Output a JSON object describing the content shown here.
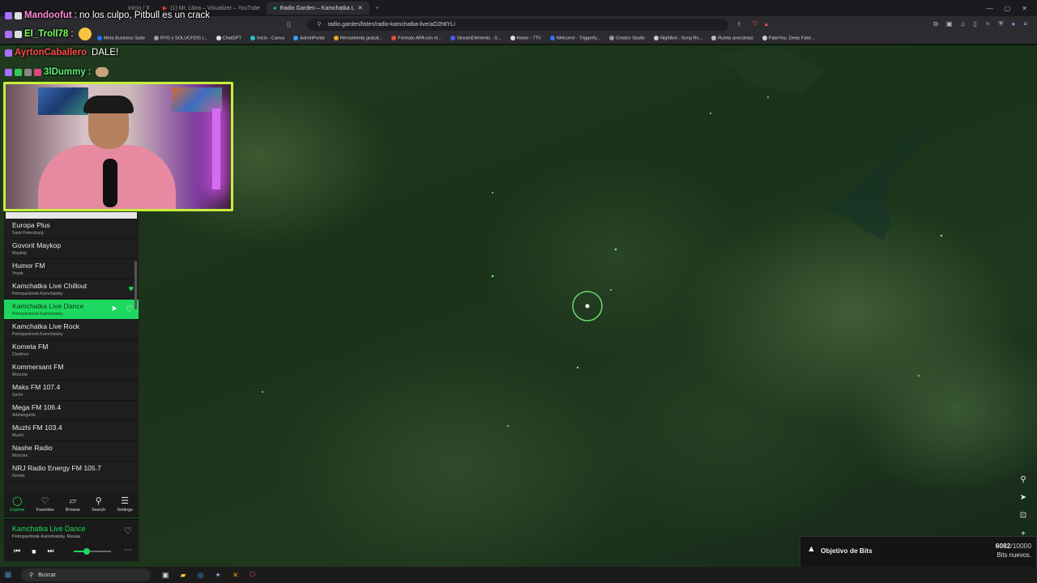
{
  "browser": {
    "tabs": [
      {
        "label": "Inicio / X",
        "active": false
      },
      {
        "label": "(1) Mr. Libra – Visualizer – YouTube",
        "active": false
      },
      {
        "label": "Radio Garden – Kamchatka L",
        "active": true
      }
    ],
    "url": "radio.garden/listen/radio-kamchatka-live/aO2h8YLi",
    "bookmarks": [
      {
        "label": "Meta Business Suite",
        "color": "#1877f2"
      },
      {
        "label": "RYG y SOLUCFDIS |...",
        "color": "#999999"
      },
      {
        "label": "ChatGPT",
        "color": "#dddddd"
      },
      {
        "label": "Inicio - Canva",
        "color": "#20c4cb"
      },
      {
        "label": "AdminPortal",
        "color": "#3aa0ff"
      },
      {
        "label": "Herramienta gratuit...",
        "color": "#f5a623"
      },
      {
        "label": "Formato APA con el...",
        "color": "#e74c3c"
      },
      {
        "label": "StreamElements - S...",
        "color": "#4a5bff"
      },
      {
        "label": "Home - 7TV",
        "color": "#dddddd"
      },
      {
        "label": "Welcome - Triggerfy...",
        "color": "#3a6dff"
      },
      {
        "label": "Creator Studio",
        "color": "#999999"
      },
      {
        "label": "Nightbot - Song Re...",
        "color": "#cccccc"
      },
      {
        "label": "Ruleta anecdotas",
        "color": "#bbbbbb"
      },
      {
        "label": "FakeYou. Deep Fake...",
        "color": "#cccccc"
      }
    ]
  },
  "chat": {
    "lines": [
      {
        "user": "Mandoofut",
        "sep": ":",
        "message": "no los culpo, Pitbull es un crack",
        "color": "#ff8ad8"
      },
      {
        "user": "El_Troll78",
        "sep": ":",
        "message": "",
        "color": "#7cff5a"
      },
      {
        "user": "AyrtonCaballero",
        "sep": "",
        "message": "DALE!",
        "color": "#ff4a4a"
      },
      {
        "user": "3lDummy",
        "sep": ":",
        "message": "",
        "color": "#5ff07a"
      }
    ]
  },
  "stations": [
    {
      "name": "Europa Plus",
      "city": "Saint Petersburg",
      "favorite": false,
      "active": false
    },
    {
      "name": "Govorit Maykop",
      "city": "Maykop",
      "favorite": false,
      "active": false
    },
    {
      "name": "Humor FM",
      "city": "Yeysk",
      "favorite": false,
      "active": false
    },
    {
      "name": "Kamchatka Live Chillout",
      "city": "Petropavlovsk-Kamchatsky",
      "favorite": true,
      "active": false
    },
    {
      "name": "Kamchatka Live Dance",
      "city": "Petropavlovsk-Kamchatsky",
      "favorite": false,
      "active": true
    },
    {
      "name": "Kamchatka Live Rock",
      "city": "Petropavlovsk-Kamchatsky",
      "favorite": false,
      "active": false
    },
    {
      "name": "Kometa FM",
      "city": "Chekhov",
      "favorite": false,
      "active": false
    },
    {
      "name": "Kommersant FM",
      "city": "Moscow",
      "favorite": false,
      "active": false
    },
    {
      "name": "Maks FM 107.4",
      "city": "Sochi",
      "favorite": false,
      "active": false
    },
    {
      "name": "Mega FM 106.4",
      "city": "Arkhangelsk",
      "favorite": false,
      "active": false
    },
    {
      "name": "Muzhi FM 103.4",
      "city": "Muzhi",
      "favorite": false,
      "active": false
    },
    {
      "name": "Nashe Radio",
      "city": "Moscow",
      "favorite": false,
      "active": false
    },
    {
      "name": "NRJ Radio Energy FM 105.7",
      "city": "Norilsk",
      "favorite": false,
      "active": false
    }
  ],
  "nav": {
    "explore": "Explore",
    "favorites": "Favorites",
    "browse": "Browse",
    "search": "Search",
    "settings": "Settings"
  },
  "player": {
    "title": "Kamchatka Live Dance",
    "location": "Petropavlovsk-Kamchatsky, Russia",
    "volume_fraction": 0.35
  },
  "bits_goal": {
    "title": "Objetivo de Bits",
    "current": "6082",
    "total": "/10000",
    "current_value": 6082,
    "total_value": 10000,
    "subtitle": "Bits nuevos."
  },
  "taskbar": {
    "search_placeholder": "Buscar"
  },
  "colors": {
    "accent": "#1ed760",
    "webcam_border": "#c6ef3b"
  }
}
